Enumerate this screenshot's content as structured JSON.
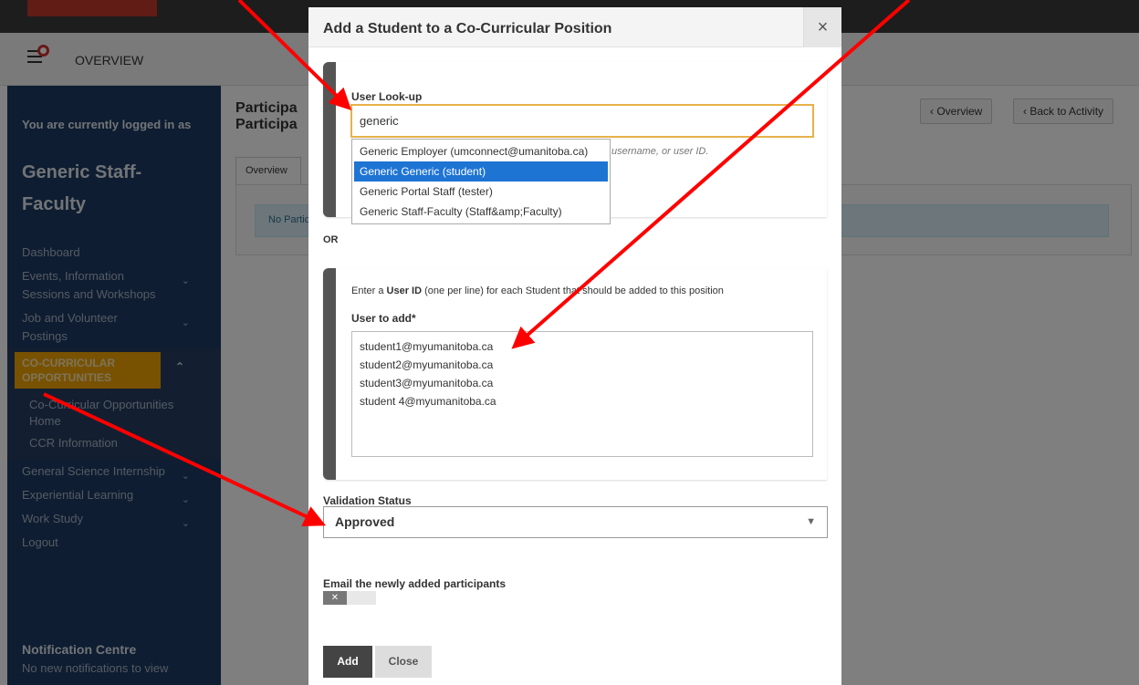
{
  "nav": {
    "overview_label": "OVERVIEW"
  },
  "sidebar": {
    "logged_in_text": "You are currently logged in as",
    "user_name": "Generic Staff-Faculty",
    "items": [
      {
        "label": "Dashboard",
        "has_children": false
      },
      {
        "label": "Events, Information Sessions and Workshops",
        "has_children": true
      },
      {
        "label": "Job and Volunteer Postings",
        "has_children": true
      }
    ],
    "active_section": {
      "label": "CO-CURRICULAR OPPORTUNITIES",
      "children": [
        "Co-Curricular Opportunities Home",
        "CCR Information"
      ]
    },
    "items_after": [
      {
        "label": "General Science Internship",
        "has_children": true
      },
      {
        "label": "Experiential Learning",
        "has_children": true
      },
      {
        "label": "Work Study",
        "has_children": true
      },
      {
        "label": "Logout",
        "has_children": false
      }
    ],
    "notification_title": "Notification Centre",
    "notification_text": "No new notifications to view",
    "chevron_down": "⌄",
    "chevron_up": "⌃"
  },
  "content": {
    "title_line1": "Participa",
    "title_line2": "Participa",
    "overview_button": "‹ Overview",
    "back_button": "‹ Back to Activity",
    "tab_overview": "Overview",
    "alert_text": "No Partic"
  },
  "modal": {
    "title": "Add a Student to a Co-Curricular Position",
    "close_glyph": "×",
    "user_lookup_label": "User Look-up",
    "user_lookup_value": "generic",
    "help_text": "username, or user ID.",
    "autocomplete": [
      {
        "label": "Generic Employer (umconnect@umanitoba.ca)",
        "selected": false
      },
      {
        "label": "Generic Generic (student)",
        "selected": true
      },
      {
        "label": "Generic Portal Staff (tester)",
        "selected": false
      },
      {
        "label": "Generic Staff-Faculty (Staff&amp;Faculty)",
        "selected": false
      }
    ],
    "or_label": "OR",
    "enter_prefix": "Enter a ",
    "enter_bold": "User ID",
    "enter_suffix": " (one per line) for each Student that should be added to this position",
    "users_label": "User to add*",
    "users_value": "student1@myumanitoba.ca\nstudent2@myumanitoba.ca\nstudent3@myumanitoba.ca\nstudent 4@myumanitoba.ca",
    "validation_label": "Validation Status",
    "validation_value": "Approved",
    "email_label": "Email the newly added participants",
    "toggle_glyph": "✕",
    "toggle_on": false,
    "add_button": "Add",
    "close_button": "Close"
  },
  "colors": {
    "sidebar_bg": "#1c3a63",
    "active_section": "#f0a500",
    "autocomplete_selected": "#1e74d3",
    "input_focus": "#e7b24a",
    "annotation_arrow": "#ff0000"
  }
}
